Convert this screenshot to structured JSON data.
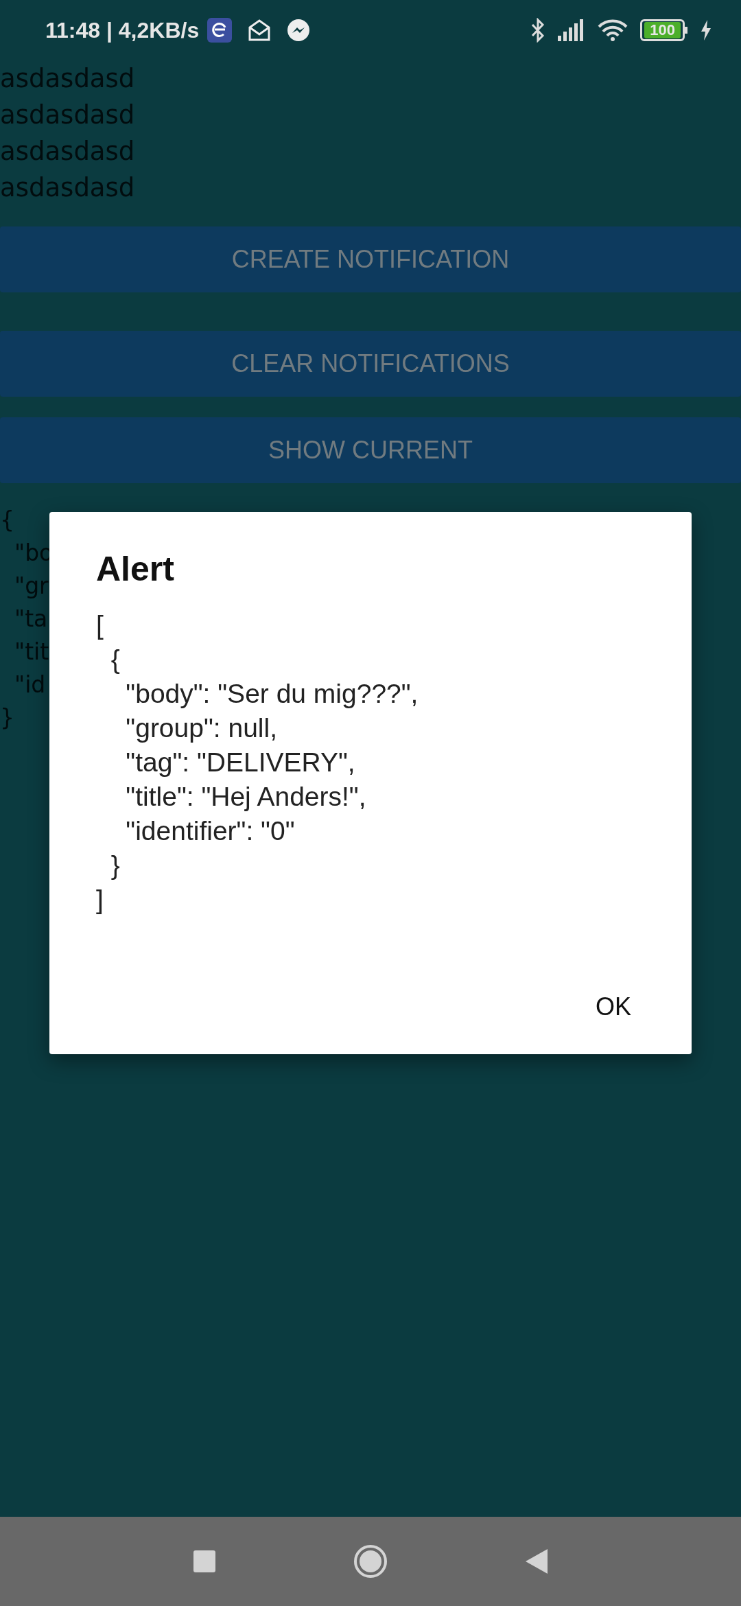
{
  "status_bar": {
    "time": "11:48 | 4,2KB/s",
    "battery": "100"
  },
  "text_lines": [
    "asdasdasd",
    "asdasdasd",
    "asdasdasd",
    "asdasdasd"
  ],
  "buttons": [
    {
      "label": "CREATE NOTIFICATION"
    },
    {
      "label": "CLEAR NOTIFICATIONS"
    },
    {
      "label": "SHOW CURRENT"
    }
  ],
  "output_lines": [
    "{",
    "  \"bo",
    "  \"gr",
    "  \"ta",
    "  \"tit",
    "  \"id",
    "}"
  ],
  "dialog": {
    "title": "Alert",
    "message_lines": [
      "[",
      "  {",
      "    \"body\": \"Ser du mig???\",",
      "    \"group\": null,",
      "    \"tag\": \"DELIVERY\",",
      "    \"title\": \"Hej Anders!\",",
      "    \"identifier\": \"0\"",
      "  }",
      "]"
    ],
    "button": "OK"
  }
}
